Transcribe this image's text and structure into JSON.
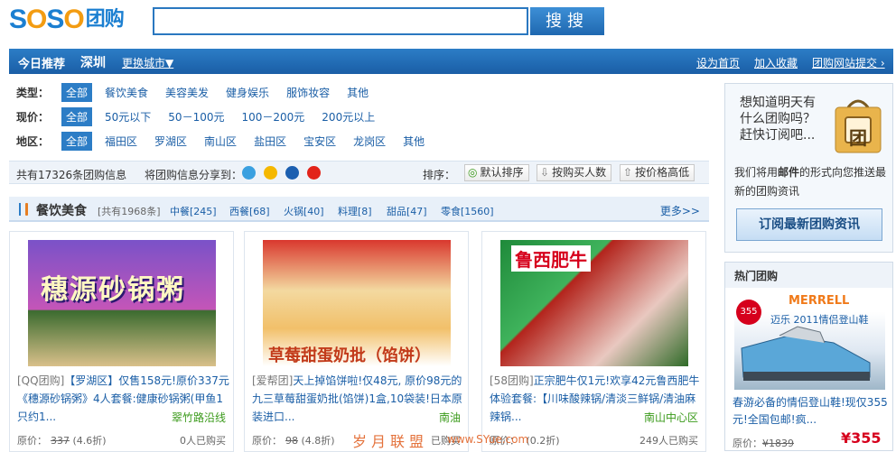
{
  "logo": {
    "part1": "S",
    "part2": "O",
    "part3": "S",
    "part4": "O",
    "tail": "团购"
  },
  "search": {
    "value": "",
    "button": "搜搜"
  },
  "nav": {
    "today": "今日推荐",
    "city": "深圳",
    "change_city": "更换城市▼",
    "links": [
      "设为首页",
      "加入收藏",
      "团购网站提交 ›"
    ]
  },
  "filters": [
    {
      "label": "类型：",
      "options": [
        "全部",
        "餐饮美食",
        "美容美发",
        "健身娱乐",
        "服饰妆容",
        "其他"
      ]
    },
    {
      "label": "现价：",
      "options": [
        "全部",
        "50元以下",
        "50－100元",
        "100－200元",
        "200元以上"
      ]
    },
    {
      "label": "地区：",
      "options": [
        "全部",
        "福田区",
        "罗湖区",
        "南山区",
        "盐田区",
        "宝安区",
        "龙岗区",
        "其他"
      ]
    }
  ],
  "bar": {
    "total": "共有17326条团购信息",
    "share": "将团购信息分享到：",
    "sort_label": "排序：",
    "sorts": [
      "默认排序",
      "按购买人数",
      "按价格高低"
    ]
  },
  "category": {
    "title": "餐饮美食",
    "count": "[共有1968条]",
    "subs": [
      "中餐[245]",
      "西餐[68]",
      "火锅[40]",
      "料理[8]",
      "甜品[47]",
      "零食[1560]"
    ],
    "more": "更多>>"
  },
  "deals": [
    {
      "source": "[QQ团购]",
      "text": "【罗湖区】仅售158元!原价337元《穗源砂锅粥》4人套餐:健康砂锅粥(甲鱼1只约1...",
      "location": "翠竹路沿线",
      "price_label": "原价：",
      "orig": "337",
      "discount": "(4.6折)",
      "bought": "0人已购买",
      "img_text": "穗源砂锅粥"
    },
    {
      "source": "[爱帮团]",
      "text": "天上掉馅饼啦!仅48元, 原价98元的九三草莓甜蛋奶批(馅饼)1盒,10袋装!日本原装进口...",
      "location": "南油",
      "price_label": "原价：",
      "orig": "98",
      "discount": "(4.8折)",
      "bought": "已购买",
      "img_text": "草莓甜蛋奶批（馅饼）"
    },
    {
      "source": "[58团购]",
      "text": "正宗肥牛仅1元!欢享42元鲁西肥牛体验套餐:【川味酸辣锅/清淡三鲜锅/清油麻辣锅...",
      "location": "南山中心区",
      "price_label": "原价：",
      "orig": "",
      "discount": "(0.2折)",
      "bought": "249人已购买",
      "img_text": "鲁西肥牛"
    }
  ],
  "subscribe": {
    "question": "想知道明天有什么团购吗？赶快订阅吧...",
    "bag_char": "团",
    "desc_pre": "我们将用",
    "desc_bold": "邮件",
    "desc_post": "的形式向您推送最新的团购资讯",
    "button": "订阅最新团购资讯"
  },
  "hot": {
    "title": "热门团购",
    "brand": "MERRELL",
    "img_caption": "迈乐 2011情侣登山鞋",
    "text": "春游必备的情侣登山鞋!现仅355元!全国包邮!疯...",
    "price_label": "原价：",
    "orig": "¥1839",
    "price": "¥355",
    "discount_badge": "355"
  },
  "watermark": {
    "cn": "岁月联盟",
    "url": "www.SYue.com"
  },
  "colors": {
    "brand_blue": "#1b7fd1",
    "nav_blue": "#2c7dc6",
    "price_red": "#d6001c",
    "loc_green": "#3a9a1a"
  }
}
